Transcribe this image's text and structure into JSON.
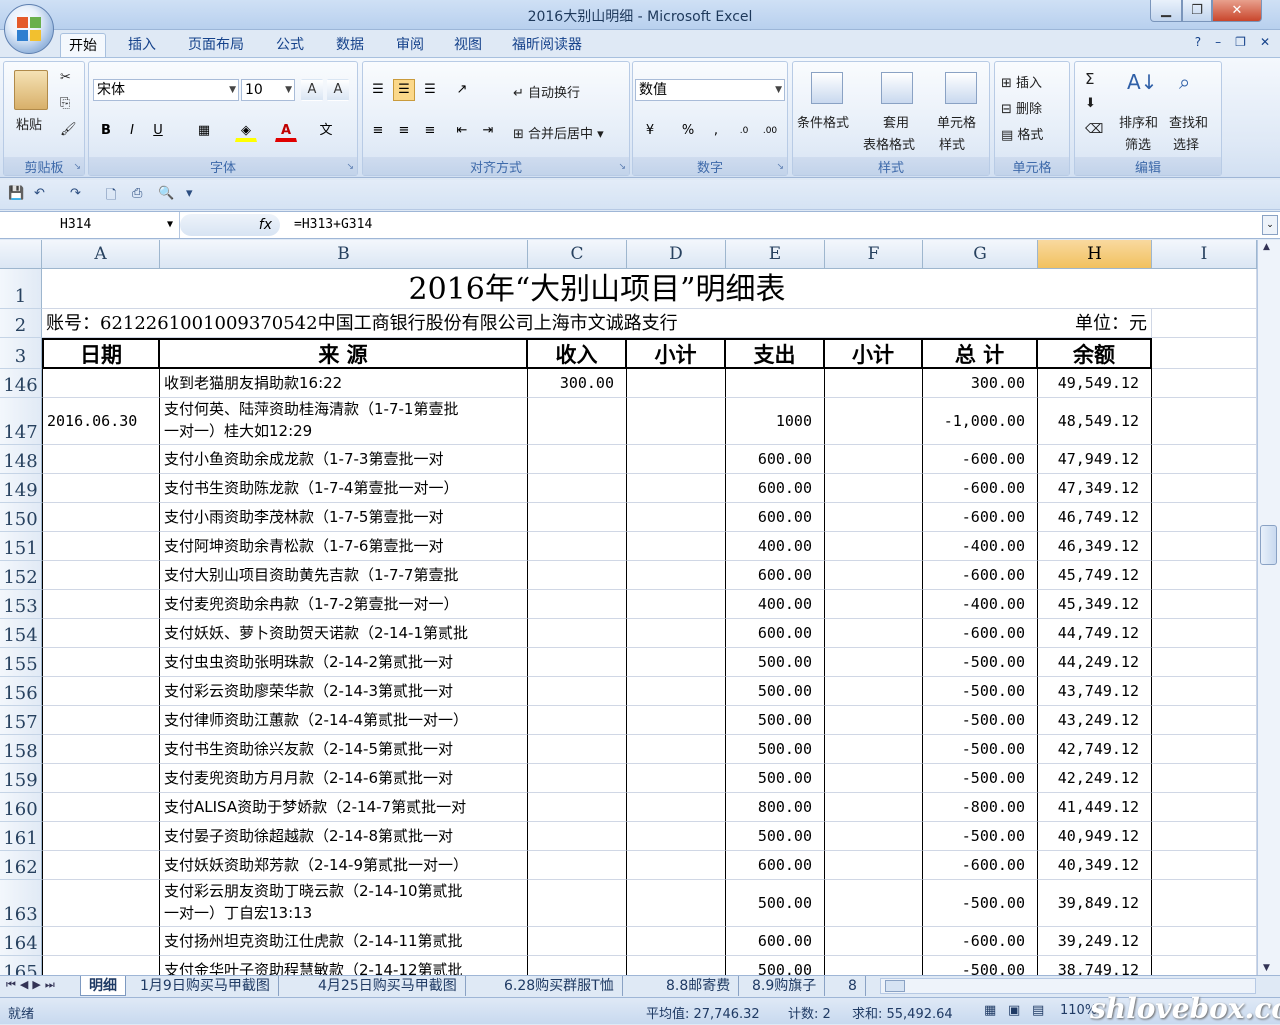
{
  "window": {
    "title": "2016大别山明细 - Microsoft Excel"
  },
  "tabs": [
    "开始",
    "插入",
    "页面布局",
    "公式",
    "数据",
    "审阅",
    "视图",
    "福昕阅读器"
  ],
  "ribbon": {
    "clipboard": {
      "label": "剪贴板",
      "paste": "粘贴"
    },
    "font": {
      "label": "字体",
      "name": "宋体",
      "size": "10"
    },
    "alignment": {
      "label": "对齐方式",
      "wrap": "自动换行",
      "merge": "合并后居中"
    },
    "number": {
      "label": "数字",
      "format": "数值"
    },
    "styles": {
      "label": "样式",
      "conditional": "条件格式",
      "table_fmt_1": "套用",
      "table_fmt_2": "表格格式",
      "cell_style_1": "单元格",
      "cell_style_2": "样式"
    },
    "cells": {
      "label": "单元格",
      "insert": "插入",
      "delete": "删除",
      "format": "格式"
    },
    "editing": {
      "label": "编辑",
      "sort_1": "排序和",
      "sort_2": "筛选",
      "find_1": "查找和",
      "find_2": "选择"
    }
  },
  "formula_bar": {
    "name_box": "H314",
    "fx": "fx",
    "formula": "=H313+G314"
  },
  "columns": [
    "A",
    "B",
    "C",
    "D",
    "E",
    "F",
    "G",
    "H",
    "I"
  ],
  "sheet": {
    "title": "2016年“大别山项目”明细表",
    "account": "账号：6212261001009370542中国工商银行股份有限公司上海市文诚路支行",
    "unit": "单位：元",
    "headers": [
      "日期",
      "来 源",
      "收入",
      "小计",
      "支出",
      "小计",
      "总 计",
      "余额"
    ],
    "rows": [
      {
        "n": "146",
        "date": "",
        "src": "收到老猫朋友捐助款16:22",
        "src2": "",
        "in": "300.00",
        "out": "",
        "total": "300.00",
        "bal": "49,549.12"
      },
      {
        "n": "147",
        "date": "2016.06.30",
        "src": "支付何英、陆萍资助桂海清款（1-7-1第壹批",
        "src2": "一对一）桂大如12:29",
        "in": "",
        "out": "1000",
        "total": "-1,000.00",
        "bal": "48,549.12"
      },
      {
        "n": "148",
        "date": "",
        "src": "支付小鱼资助余成龙款（1-7-3第壹批一对",
        "src2": "",
        "in": "",
        "out": "600.00",
        "total": "-600.00",
        "bal": "47,949.12"
      },
      {
        "n": "149",
        "date": "",
        "src": "支付书生资助陈龙款（1-7-4第壹批一对一）",
        "src2": "",
        "in": "",
        "out": "600.00",
        "total": "-600.00",
        "bal": "47,349.12"
      },
      {
        "n": "150",
        "date": "",
        "src": "支付小雨资助李茂林款（1-7-5第壹批一对",
        "src2": "",
        "in": "",
        "out": "600.00",
        "total": "-600.00",
        "bal": "46,749.12"
      },
      {
        "n": "151",
        "date": "",
        "src": "支付阿坤资助余青松款（1-7-6第壹批一对",
        "src2": "",
        "in": "",
        "out": "400.00",
        "total": "-400.00",
        "bal": "46,349.12"
      },
      {
        "n": "152",
        "date": "",
        "src": "支付大别山项目资助黄先吉款（1-7-7第壹批",
        "src2": "",
        "in": "",
        "out": "600.00",
        "total": "-600.00",
        "bal": "45,749.12"
      },
      {
        "n": "153",
        "date": "",
        "src": "支付麦兜资助余冉款（1-7-2第壹批一对一）",
        "src2": "",
        "in": "",
        "out": "400.00",
        "total": "-400.00",
        "bal": "45,349.12"
      },
      {
        "n": "154",
        "date": "",
        "src": "支付妖妖、萝卜资助贺天诺款（2-14-1第贰批",
        "src2": "",
        "in": "",
        "out": "600.00",
        "total": "-600.00",
        "bal": "44,749.12"
      },
      {
        "n": "155",
        "date": "",
        "src": "支付虫虫资助张明珠款（2-14-2第贰批一对",
        "src2": "",
        "in": "",
        "out": "500.00",
        "total": "-500.00",
        "bal": "44,249.12"
      },
      {
        "n": "156",
        "date": "",
        "src": "支付彩云资助廖荣华款（2-14-3第贰批一对",
        "src2": "",
        "in": "",
        "out": "500.00",
        "total": "-500.00",
        "bal": "43,749.12"
      },
      {
        "n": "157",
        "date": "",
        "src": "支付律师资助江蕙款（2-14-4第贰批一对一）",
        "src2": "",
        "in": "",
        "out": "500.00",
        "total": "-500.00",
        "bal": "43,249.12"
      },
      {
        "n": "158",
        "date": "",
        "src": "支付书生资助徐兴友款（2-14-5第贰批一对",
        "src2": "",
        "in": "",
        "out": "500.00",
        "total": "-500.00",
        "bal": "42,749.12"
      },
      {
        "n": "159",
        "date": "",
        "src": "支付麦兜资助方月月款（2-14-6第贰批一对",
        "src2": "",
        "in": "",
        "out": "500.00",
        "total": "-500.00",
        "bal": "42,249.12"
      },
      {
        "n": "160",
        "date": "",
        "src": "支付ALISA资助于梦娇款（2-14-7第贰批一对",
        "src2": "",
        "in": "",
        "out": "800.00",
        "total": "-800.00",
        "bal": "41,449.12"
      },
      {
        "n": "161",
        "date": "",
        "src": "支付晏子资助徐超越款（2-14-8第贰批一对",
        "src2": "",
        "in": "",
        "out": "500.00",
        "total": "-500.00",
        "bal": "40,949.12"
      },
      {
        "n": "162",
        "date": "",
        "src": "支付妖妖资助郑芳款（2-14-9第贰批一对一）",
        "src2": "",
        "in": "",
        "out": "600.00",
        "total": "-600.00",
        "bal": "40,349.12"
      },
      {
        "n": "163",
        "date": "",
        "src": "支付彩云朋友资助丁晓云款（2-14-10第贰批",
        "src2": "一对一）丁自宏13:13",
        "in": "",
        "out": "500.00",
        "total": "-500.00",
        "bal": "39,849.12"
      },
      {
        "n": "164",
        "date": "",
        "src": "支付扬州坦克资助江仕虎款（2-14-11第贰批",
        "src2": "",
        "in": "",
        "out": "600.00",
        "total": "-600.00",
        "bal": "39,249.12"
      },
      {
        "n": "165",
        "date": "",
        "src": "支付金华叶子资助程慧敏款（2-14-12第贰批",
        "src2": "",
        "in": "",
        "out": "500.00",
        "total": "-500.00",
        "bal": "38,749.12"
      }
    ]
  },
  "sheet_tabs": [
    "明细",
    "1月9日购买马甲截图",
    "4月25日购买马甲截图",
    "6.28购买群服T恤",
    "8.8邮寄费",
    "8.9购旗子",
    "8"
  ],
  "status": {
    "ready": "就绪",
    "average": "平均值: 27,746.32",
    "count": "计数: 2",
    "sum": "求和: 55,492.64",
    "zoom": "110%"
  },
  "watermark": "shlovebox.com"
}
